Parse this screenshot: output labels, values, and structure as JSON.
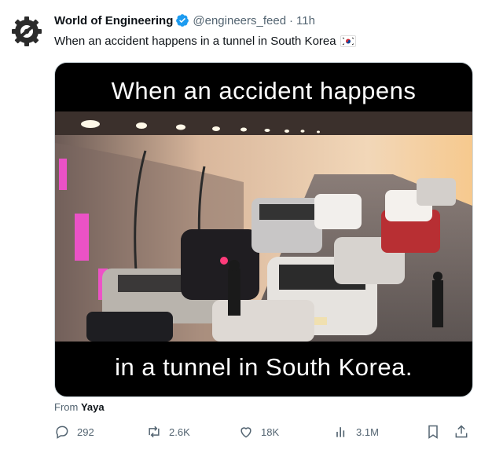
{
  "author": {
    "name": "World of Engineering",
    "handle": "@engineers_feed",
    "separator": "·",
    "time": "11h"
  },
  "tweet_text": "When an accident happens in a tunnel in South Korea",
  "media": {
    "caption_top": "When an accident happens",
    "caption_bottom": "in a tunnel in South Korea."
  },
  "from": {
    "prefix": "From",
    "source": "Yaya"
  },
  "actions": {
    "replies": "292",
    "reposts": "2.6K",
    "likes": "18K",
    "views": "3.1M"
  },
  "colors": {
    "verified": "#1d9bf0",
    "secondary_text": "#536471",
    "tunnel_wall": "#e8c9a8",
    "neon_pink": "#ff4fd8"
  },
  "icons": [
    "gear-logo-icon",
    "verified-badge-icon",
    "south-korea-flag-icon",
    "reply-icon",
    "repost-icon",
    "like-icon",
    "views-icon",
    "bookmark-icon",
    "share-icon"
  ]
}
